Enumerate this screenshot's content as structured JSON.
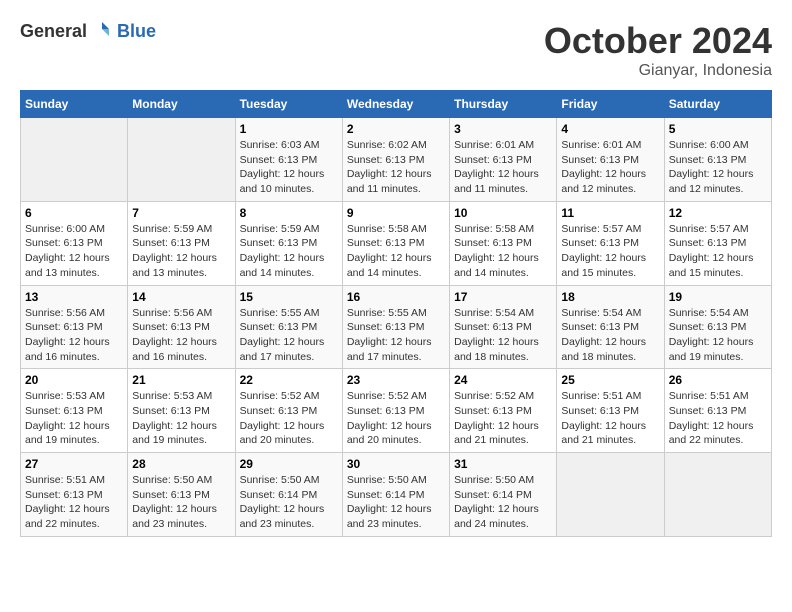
{
  "header": {
    "logo_general": "General",
    "logo_blue": "Blue",
    "month": "October 2024",
    "location": "Gianyar, Indonesia"
  },
  "weekdays": [
    "Sunday",
    "Monday",
    "Tuesday",
    "Wednesday",
    "Thursday",
    "Friday",
    "Saturday"
  ],
  "weeks": [
    [
      {
        "day": "",
        "sunrise": "",
        "sunset": "",
        "daylight": "",
        "empty": true
      },
      {
        "day": "",
        "sunrise": "",
        "sunset": "",
        "daylight": "",
        "empty": true
      },
      {
        "day": "1",
        "sunrise": "Sunrise: 6:03 AM",
        "sunset": "Sunset: 6:13 PM",
        "daylight": "Daylight: 12 hours and 10 minutes."
      },
      {
        "day": "2",
        "sunrise": "Sunrise: 6:02 AM",
        "sunset": "Sunset: 6:13 PM",
        "daylight": "Daylight: 12 hours and 11 minutes."
      },
      {
        "day": "3",
        "sunrise": "Sunrise: 6:01 AM",
        "sunset": "Sunset: 6:13 PM",
        "daylight": "Daylight: 12 hours and 11 minutes."
      },
      {
        "day": "4",
        "sunrise": "Sunrise: 6:01 AM",
        "sunset": "Sunset: 6:13 PM",
        "daylight": "Daylight: 12 hours and 12 minutes."
      },
      {
        "day": "5",
        "sunrise": "Sunrise: 6:00 AM",
        "sunset": "Sunset: 6:13 PM",
        "daylight": "Daylight: 12 hours and 12 minutes."
      }
    ],
    [
      {
        "day": "6",
        "sunrise": "Sunrise: 6:00 AM",
        "sunset": "Sunset: 6:13 PM",
        "daylight": "Daylight: 12 hours and 13 minutes."
      },
      {
        "day": "7",
        "sunrise": "Sunrise: 5:59 AM",
        "sunset": "Sunset: 6:13 PM",
        "daylight": "Daylight: 12 hours and 13 minutes."
      },
      {
        "day": "8",
        "sunrise": "Sunrise: 5:59 AM",
        "sunset": "Sunset: 6:13 PM",
        "daylight": "Daylight: 12 hours and 14 minutes."
      },
      {
        "day": "9",
        "sunrise": "Sunrise: 5:58 AM",
        "sunset": "Sunset: 6:13 PM",
        "daylight": "Daylight: 12 hours and 14 minutes."
      },
      {
        "day": "10",
        "sunrise": "Sunrise: 5:58 AM",
        "sunset": "Sunset: 6:13 PM",
        "daylight": "Daylight: 12 hours and 14 minutes."
      },
      {
        "day": "11",
        "sunrise": "Sunrise: 5:57 AM",
        "sunset": "Sunset: 6:13 PM",
        "daylight": "Daylight: 12 hours and 15 minutes."
      },
      {
        "day": "12",
        "sunrise": "Sunrise: 5:57 AM",
        "sunset": "Sunset: 6:13 PM",
        "daylight": "Daylight: 12 hours and 15 minutes."
      }
    ],
    [
      {
        "day": "13",
        "sunrise": "Sunrise: 5:56 AM",
        "sunset": "Sunset: 6:13 PM",
        "daylight": "Daylight: 12 hours and 16 minutes."
      },
      {
        "day": "14",
        "sunrise": "Sunrise: 5:56 AM",
        "sunset": "Sunset: 6:13 PM",
        "daylight": "Daylight: 12 hours and 16 minutes."
      },
      {
        "day": "15",
        "sunrise": "Sunrise: 5:55 AM",
        "sunset": "Sunset: 6:13 PM",
        "daylight": "Daylight: 12 hours and 17 minutes."
      },
      {
        "day": "16",
        "sunrise": "Sunrise: 5:55 AM",
        "sunset": "Sunset: 6:13 PM",
        "daylight": "Daylight: 12 hours and 17 minutes."
      },
      {
        "day": "17",
        "sunrise": "Sunrise: 5:54 AM",
        "sunset": "Sunset: 6:13 PM",
        "daylight": "Daylight: 12 hours and 18 minutes."
      },
      {
        "day": "18",
        "sunrise": "Sunrise: 5:54 AM",
        "sunset": "Sunset: 6:13 PM",
        "daylight": "Daylight: 12 hours and 18 minutes."
      },
      {
        "day": "19",
        "sunrise": "Sunrise: 5:54 AM",
        "sunset": "Sunset: 6:13 PM",
        "daylight": "Daylight: 12 hours and 19 minutes."
      }
    ],
    [
      {
        "day": "20",
        "sunrise": "Sunrise: 5:53 AM",
        "sunset": "Sunset: 6:13 PM",
        "daylight": "Daylight: 12 hours and 19 minutes."
      },
      {
        "day": "21",
        "sunrise": "Sunrise: 5:53 AM",
        "sunset": "Sunset: 6:13 PM",
        "daylight": "Daylight: 12 hours and 19 minutes."
      },
      {
        "day": "22",
        "sunrise": "Sunrise: 5:52 AM",
        "sunset": "Sunset: 6:13 PM",
        "daylight": "Daylight: 12 hours and 20 minutes."
      },
      {
        "day": "23",
        "sunrise": "Sunrise: 5:52 AM",
        "sunset": "Sunset: 6:13 PM",
        "daylight": "Daylight: 12 hours and 20 minutes."
      },
      {
        "day": "24",
        "sunrise": "Sunrise: 5:52 AM",
        "sunset": "Sunset: 6:13 PM",
        "daylight": "Daylight: 12 hours and 21 minutes."
      },
      {
        "day": "25",
        "sunrise": "Sunrise: 5:51 AM",
        "sunset": "Sunset: 6:13 PM",
        "daylight": "Daylight: 12 hours and 21 minutes."
      },
      {
        "day": "26",
        "sunrise": "Sunrise: 5:51 AM",
        "sunset": "Sunset: 6:13 PM",
        "daylight": "Daylight: 12 hours and 22 minutes."
      }
    ],
    [
      {
        "day": "27",
        "sunrise": "Sunrise: 5:51 AM",
        "sunset": "Sunset: 6:13 PM",
        "daylight": "Daylight: 12 hours and 22 minutes."
      },
      {
        "day": "28",
        "sunrise": "Sunrise: 5:50 AM",
        "sunset": "Sunset: 6:13 PM",
        "daylight": "Daylight: 12 hours and 23 minutes."
      },
      {
        "day": "29",
        "sunrise": "Sunrise: 5:50 AM",
        "sunset": "Sunset: 6:14 PM",
        "daylight": "Daylight: 12 hours and 23 minutes."
      },
      {
        "day": "30",
        "sunrise": "Sunrise: 5:50 AM",
        "sunset": "Sunset: 6:14 PM",
        "daylight": "Daylight: 12 hours and 23 minutes."
      },
      {
        "day": "31",
        "sunrise": "Sunrise: 5:50 AM",
        "sunset": "Sunset: 6:14 PM",
        "daylight": "Daylight: 12 hours and 24 minutes."
      },
      {
        "day": "",
        "sunrise": "",
        "sunset": "",
        "daylight": "",
        "empty": true
      },
      {
        "day": "",
        "sunrise": "",
        "sunset": "",
        "daylight": "",
        "empty": true
      }
    ]
  ]
}
